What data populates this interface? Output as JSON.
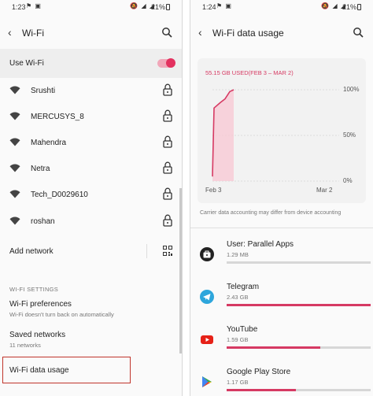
{
  "left": {
    "status": {
      "time": "1:23",
      "battery": "21%"
    },
    "title": "Wi-Fi",
    "use_wifi": {
      "label": "Use Wi-Fi",
      "on": true
    },
    "networks": [
      {
        "name": "Srushti",
        "locked": true
      },
      {
        "name": "MERCUSYS_8",
        "locked": true
      },
      {
        "name": "Mahendra",
        "locked": true
      },
      {
        "name": "Netra",
        "locked": true
      },
      {
        "name": "Tech_D0029610",
        "locked": true
      },
      {
        "name": "roshan",
        "locked": true
      }
    ],
    "add_network": "Add network",
    "section_header": "WI-FI SETTINGS",
    "preferences": {
      "title": "Wi-Fi preferences",
      "subtitle": "Wi-Fi doesn't turn back on automatically"
    },
    "saved": {
      "title": "Saved networks",
      "subtitle": "11 networks"
    },
    "data_usage": {
      "title": "Wi-Fi data usage"
    }
  },
  "right": {
    "status": {
      "time": "1:24",
      "battery": "21%"
    },
    "title": "Wi-Fi data usage",
    "chart_data": {
      "type": "area",
      "title": "55.15 GB USED(FEB 3 – MAR 2)",
      "x": [
        "Feb 3",
        "Feb 4",
        "Feb 5",
        "Feb 6",
        "Feb 7",
        "Feb 8",
        "Mar 2"
      ],
      "values": [
        5,
        80,
        86,
        90,
        98,
        100,
        100
      ],
      "x_tick_labels": [
        "Feb 3",
        "Mar 2"
      ],
      "y_tick_labels": [
        "100%",
        "50%",
        "0%"
      ],
      "ylim": [
        0,
        100
      ],
      "grid": true,
      "accent": "#d63a63"
    },
    "note": "Carrier data accounting may differ from device accounting",
    "apps": [
      {
        "name": "User: Parallel Apps",
        "size": "1.29 MB",
        "usage_fraction": 0.0,
        "icon": "briefcase-icon"
      },
      {
        "name": "Telegram",
        "size": "2.43 GB",
        "usage_fraction": 1.0,
        "icon": "telegram-icon"
      },
      {
        "name": "YouTube",
        "size": "1.59 GB",
        "usage_fraction": 0.65,
        "icon": "youtube-icon"
      },
      {
        "name": "Google Play Store",
        "size": "1.17 GB",
        "usage_fraction": 0.48,
        "icon": "play-store-icon"
      }
    ]
  }
}
